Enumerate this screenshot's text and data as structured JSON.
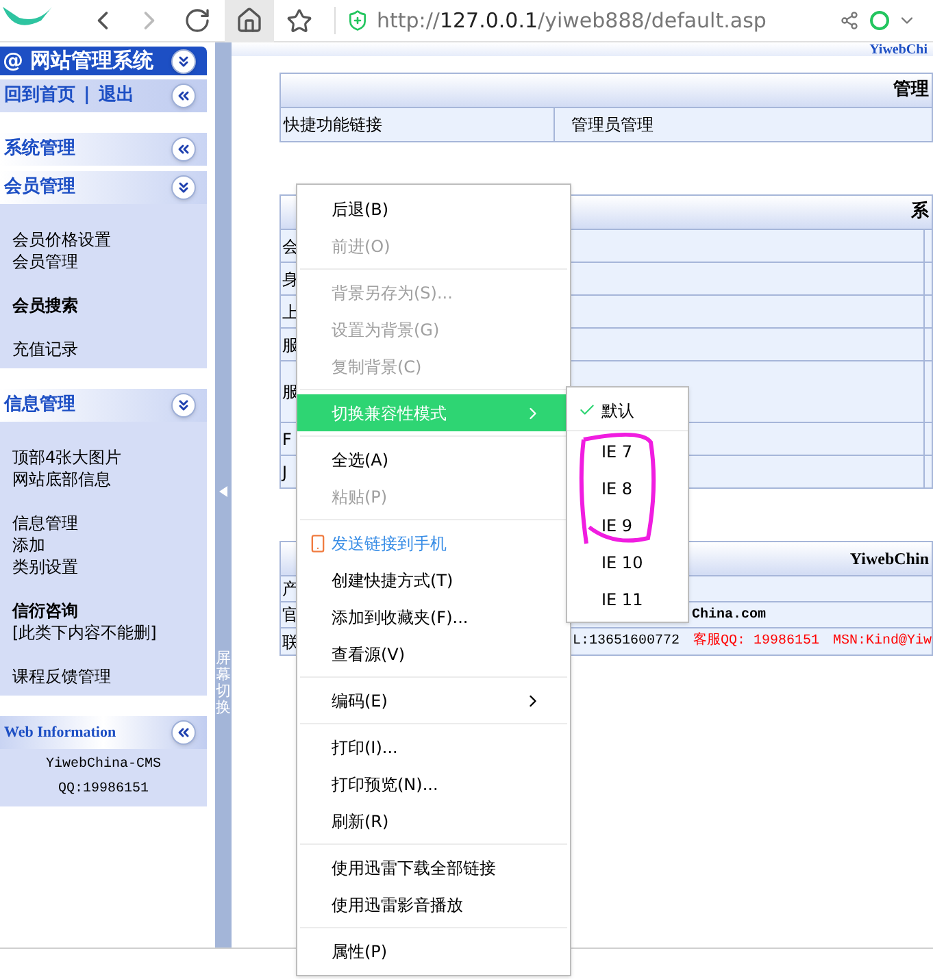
{
  "browser": {
    "url": {
      "scheme": "http://",
      "host": "127.0.0.1",
      "path": "/yiweb888/default.asp"
    }
  },
  "sidebar": {
    "title": "网站管理系统",
    "title_mark": "@",
    "home_links": [
      {
        "label": "回到首页"
      },
      {
        "label": "退出"
      }
    ],
    "home_divider": "|",
    "sections": [
      {
        "title": "系统管理",
        "expanded": false
      },
      {
        "title": "会员管理",
        "expanded": true,
        "groups": [
          [
            {
              "label": "会员价格设置",
              "bold": false
            },
            {
              "label": "会员管理",
              "bold": false
            }
          ],
          [
            {
              "label": "会员搜索",
              "bold": true
            }
          ],
          [
            {
              "label": "充值记录",
              "bold": false
            }
          ]
        ]
      },
      {
        "title": "信息管理",
        "expanded": true,
        "groups": [
          [
            {
              "label": "顶部4张大图片",
              "bold": false
            },
            {
              "label": "网站底部信息",
              "bold": false
            }
          ],
          [
            {
              "label": "信息管理",
              "bold": false
            },
            {
              "label": "添加",
              "bold": false
            },
            {
              "label": "类别设置",
              "bold": false
            }
          ],
          [
            {
              "label": "信衍咨询",
              "bold": true
            },
            {
              "label": "[此类下内容不能删]",
              "bold": false
            }
          ],
          [
            {
              "label": "课程反馈管理",
              "bold": false
            }
          ]
        ]
      }
    ],
    "info": {
      "title": "Web Information",
      "lines": [
        "YiwebChina-CMS",
        "QQ:19986151"
      ]
    }
  },
  "splitter": {
    "label": "屏幕切换"
  },
  "main": {
    "top_strip": "YiwebChi",
    "admin_table": {
      "header": "管理",
      "cells": [
        "快捷功能链接",
        "管理员管理"
      ]
    },
    "system_table": {
      "header": "系",
      "rows": [
        {
          "left": "会",
          "tall": false
        },
        {
          "left": "身",
          "tall": false
        },
        {
          "left": "上",
          "tall": false
        },
        {
          "left": "服",
          "tall": false
        },
        {
          "left": "服",
          "tall": true
        },
        {
          "left": "F",
          "tall": false
        },
        {
          "left": "J",
          "tall": false
        }
      ]
    },
    "info_table": {
      "header": "YiwebChin",
      "rows": [
        {
          "left": "产",
          "parts": []
        },
        {
          "left": "官",
          "parts": [
            {
              "text": "China.com",
              "red": false
            }
          ]
        },
        {
          "left": "联",
          "parts": [
            {
              "text": "L:13651600772",
              "red": false
            },
            {
              "text": "客服QQ: 19986151",
              "red": true
            },
            {
              "text": "MSN:Kind@Yiw",
              "red": true
            }
          ]
        }
      ]
    }
  },
  "context_menu": {
    "items": [
      {
        "kind": "item",
        "label": "后退(B)",
        "disabled": false,
        "highlighted": false
      },
      {
        "kind": "item",
        "label": "前进(O)",
        "disabled": true,
        "highlighted": false
      },
      {
        "kind": "separator"
      },
      {
        "kind": "item",
        "label": "背景另存为(S)...",
        "disabled": true,
        "highlighted": false
      },
      {
        "kind": "item",
        "label": "设置为背景(G)",
        "disabled": true,
        "highlighted": false
      },
      {
        "kind": "item",
        "label": "复制背景(C)",
        "disabled": true,
        "highlighted": false
      },
      {
        "kind": "separator"
      },
      {
        "kind": "submenu",
        "label": "切换兼容性模式",
        "disabled": false,
        "highlighted": true
      },
      {
        "kind": "separator"
      },
      {
        "kind": "item",
        "label": "全选(A)",
        "disabled": false,
        "highlighted": false
      },
      {
        "kind": "item",
        "label": "粘贴(P)",
        "disabled": true,
        "highlighted": false
      },
      {
        "kind": "separator"
      },
      {
        "kind": "phone",
        "label": "发送链接到手机",
        "disabled": false,
        "highlighted": false
      },
      {
        "kind": "item",
        "label": "创建快捷方式(T)",
        "disabled": false,
        "highlighted": false
      },
      {
        "kind": "item",
        "label": "添加到收藏夹(F)...",
        "disabled": false,
        "highlighted": false
      },
      {
        "kind": "item",
        "label": "查看源(V)",
        "disabled": false,
        "highlighted": false
      },
      {
        "kind": "separator"
      },
      {
        "kind": "submenu",
        "label": "编码(E)",
        "disabled": false,
        "highlighted": false
      },
      {
        "kind": "separator"
      },
      {
        "kind": "item",
        "label": "打印(I)...",
        "disabled": false,
        "highlighted": false
      },
      {
        "kind": "item",
        "label": "打印预览(N)...",
        "disabled": false,
        "highlighted": false
      },
      {
        "kind": "item",
        "label": "刷新(R)",
        "disabled": false,
        "highlighted": false
      },
      {
        "kind": "separator"
      },
      {
        "kind": "item",
        "label": "使用迅雷下载全部链接",
        "disabled": false,
        "highlighted": false
      },
      {
        "kind": "item",
        "label": "使用迅雷影音播放",
        "disabled": false,
        "highlighted": false
      },
      {
        "kind": "separator"
      },
      {
        "kind": "item",
        "label": "属性(P)",
        "disabled": false,
        "highlighted": false
      }
    ]
  },
  "submenu": {
    "items": [
      {
        "label": "默认",
        "checked": true
      },
      {
        "label": "IE 7",
        "checked": false
      },
      {
        "label": "IE 8",
        "checked": false
      },
      {
        "label": "IE 9",
        "checked": false
      },
      {
        "label": "IE 10",
        "checked": false
      },
      {
        "label": "IE 11",
        "checked": false
      }
    ]
  }
}
